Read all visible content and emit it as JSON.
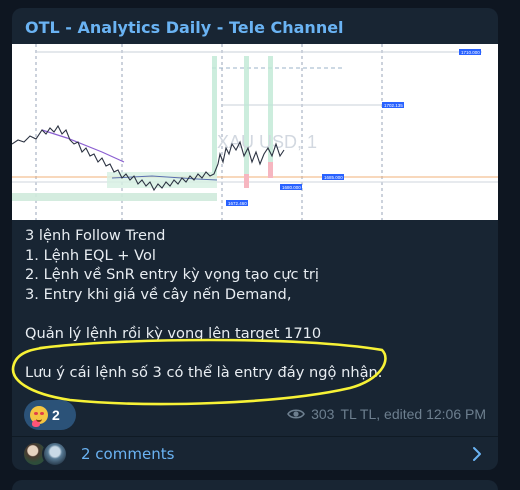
{
  "post": {
    "channel_title": "OTL - Analytics Daily - Tele Channel",
    "message_lines": [
      "3 lệnh Follow Trend",
      "1. Lệnh EQL + Vol",
      "2. Lệnh về SnR entry kỳ vọng tạo cực trị",
      "3. Entry khi giá về cây nến Demand,",
      "",
      "Quản lý lệnh rồi kỳ vọng lên target 1710",
      "",
      "Lưu ý cái lệnh số 3 có thể là entry đáy ngộ nhận."
    ],
    "reaction": {
      "emoji": "smiling-face-with-hearts",
      "count": "2"
    },
    "views": "303",
    "signature": "TL TL, edited 12:06 PM",
    "comments_label": "2 comments"
  },
  "chart_image": {
    "watermark": "XAU USD, 1",
    "price_tags": [
      "1710.000",
      "1702.135",
      "1680.000",
      "1685.000",
      "1672.460"
    ]
  },
  "colors": {
    "background": "#0e1621",
    "card": "#182533",
    "accent": "#6ab3f3",
    "text": "#e8edf2",
    "muted": "#6d7f8f",
    "highlight_ellipse": "#f7f236",
    "reaction_bg": "#2b5278"
  }
}
